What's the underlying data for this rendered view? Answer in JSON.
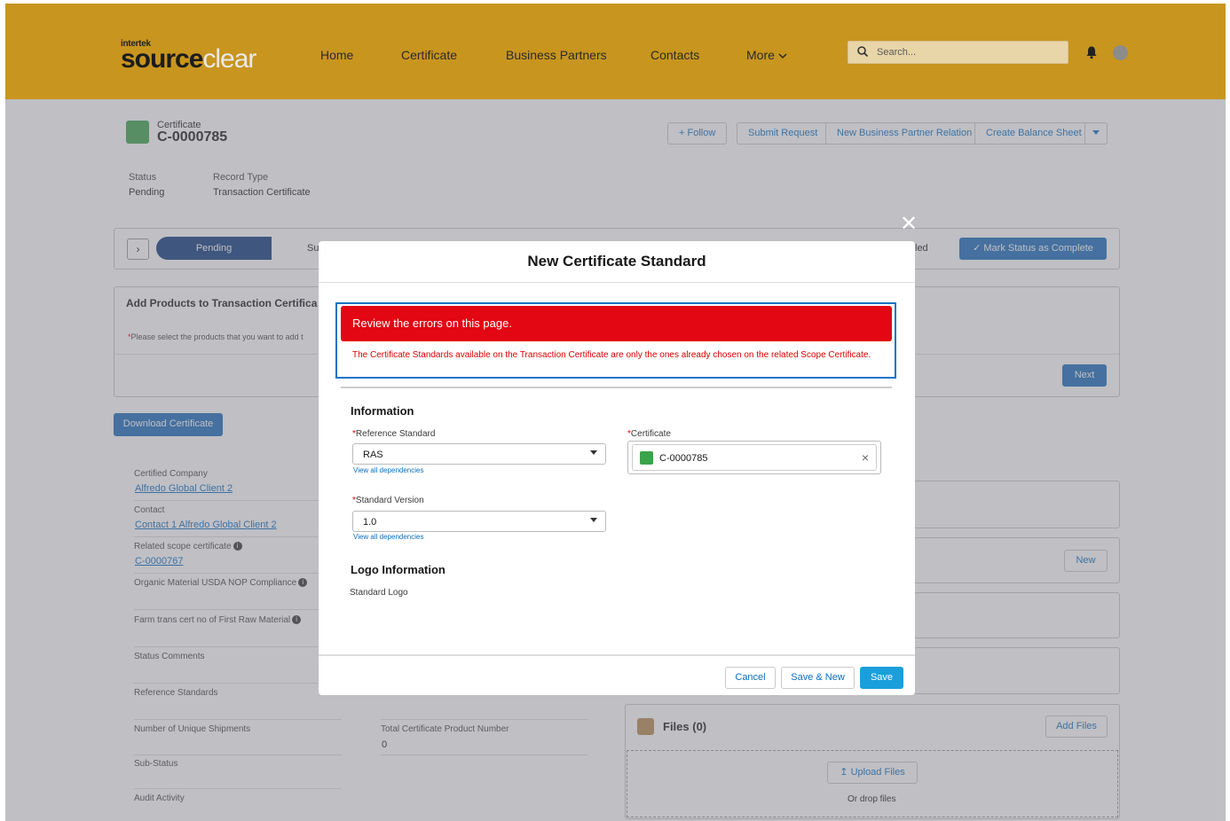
{
  "header": {
    "logo_small": "intertek",
    "logo_source": "source",
    "logo_clear": "clear",
    "nav": [
      "Home",
      "Certificate",
      "Business Partners",
      "Contacts",
      "More"
    ],
    "search_placeholder": "Search..."
  },
  "record": {
    "object_label": "Certificate",
    "name": "C-0000785",
    "status_label": "Status",
    "status_value": "Pending",
    "record_type_label": "Record Type",
    "record_type_value": "Transaction Certificate",
    "actions": [
      "Follow",
      "Submit Request",
      "New Business Partner Relation",
      "Create Balance Sheet"
    ]
  },
  "path": {
    "current_step": "Pending",
    "partial_step": "Su",
    "partial_step_right": "led",
    "mark_button": "Mark Status as Complete"
  },
  "products_card": {
    "title": "Add Products to Transaction Certifica",
    "instruction": "Please select the products that you want to add t",
    "next_button": "Next"
  },
  "download_button": "Download Certificate",
  "details": {
    "certified_company_label": "Certified Company",
    "certified_company_value": "Alfredo Global Client 2",
    "contact_label": "Contact",
    "contact_value": "Contact 1 Alfredo Global Client 2",
    "related_scope_label": "Related scope certificate",
    "related_scope_value": "C-0000767",
    "organic_label": "Organic Material USDA NOP Compliance",
    "farm_label": "Farm trans cert no of First Raw Material",
    "status_comments_label": "Status Comments",
    "reference_standards_label": "Reference Standards",
    "unique_shipments_label": "Number of Unique Shipments",
    "total_product_label": "Total Certificate Product Number",
    "total_product_value": "0",
    "sub_status_label": "Sub-Status",
    "audit_activity_label": "Audit Activity"
  },
  "side": {
    "new_button": "New",
    "files_title": "Files (0)",
    "add_files_button": "Add Files",
    "upload_button": "Upload Files",
    "drop_text": "Or drop files"
  },
  "modal": {
    "title": "New Certificate Standard",
    "error_banner": "Review the errors on this page.",
    "error_message": "The Certificate Standards available on the Transaction Certificate are only the ones already chosen on the related Scope Certificate.",
    "section_information": "Information",
    "reference_standard_label": "Reference Standard",
    "reference_standard_value": "RAS",
    "standard_version_label": "Standard Version",
    "standard_version_value": "1.0",
    "dependencies_link": "View all dependencies",
    "certificate_label": "Certificate",
    "certificate_value": "C-0000785",
    "section_logo": "Logo Information",
    "standard_logo_label": "Standard Logo",
    "cancel_button": "Cancel",
    "save_new_button": "Save & New",
    "save_button": "Save"
  },
  "colors": {
    "header": "#c8951f",
    "error": "#e30613",
    "brand": "#1a9fdd",
    "path_active": "#0e3a7c"
  }
}
